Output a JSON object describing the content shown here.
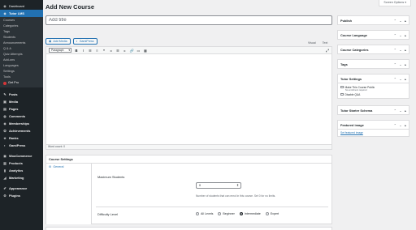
{
  "sidebar": {
    "dashboard": "Dashboard",
    "tutor_lms": "Tutor LMS",
    "tutor_sub": [
      "Courses",
      "Categories",
      "Tags",
      "Students",
      "Announcements",
      "Q & A",
      "Quiz Attempts",
      "Add-ons",
      "Languages",
      "Settings",
      "Tools"
    ],
    "get_pro": "Get Pro",
    "posts": "Posts",
    "media": "Media",
    "pages": "Pages",
    "comments": "Comments",
    "memberships": "Memberships",
    "achievements": "Achievements",
    "ranks": "Ranks",
    "gamipress": "GamiPress",
    "woocommerce": "WooCommerce",
    "products": "Products",
    "analytics": "Analytics",
    "marketing": "Marketing",
    "appearance": "Appearance",
    "plugins": "Plugins"
  },
  "header": {
    "title": "Add New Course",
    "screen_options": "Screen Options ▾"
  },
  "title_field": {
    "placeholder": "Add title"
  },
  "media_buttons": {
    "add_media": "Add Media",
    "gamipress": "GamiPress"
  },
  "editor_tabs": {
    "visual": "Visual",
    "text": "Text"
  },
  "toolbar": {
    "format": "Paragraph",
    "format_arrow": "▾",
    "bold": "B",
    "italic": "I",
    "ul": "☰",
    "ol": "≡",
    "quote": "❝",
    "align_left": "⫷",
    "align_center": "☰",
    "align_right": "⫸",
    "link": "🔗",
    "more": "▭",
    "kitchen_sink": "▦",
    "expand": "⤢"
  },
  "word_count": "Word count: 0",
  "course_settings": {
    "title": "Course Settings",
    "nav_general": "General",
    "max_students_label": "Maximum Students",
    "max_students_value": "0",
    "max_students_help": "Number of students that can enrol in this course. Set 0 for no limits.",
    "difficulty_label": "Difficulty Level",
    "levels": [
      "All Levels",
      "Beginner",
      "Intermediate",
      "Expert"
    ],
    "selected_level": "Intermediate"
  },
  "right_boxes": {
    "publish": "Publish",
    "course_language": "Course Language",
    "course_categories": "Course Categories",
    "tags": "Tags",
    "tutor_settings": "Tutor Settings",
    "make_public": "Make This Course Public",
    "no_enrollment": "No enrollment required",
    "disable_qa": "Disable Q&A",
    "tutor_starter_schema": "Tutor Starter Schema",
    "featured_image": "Featured image",
    "set_featured_image": "Set featured image",
    "box_controls": "⌃ ⌄ ▴"
  },
  "colors": {
    "sidebar_bg": "#1d2327",
    "accent": "#2271b1",
    "page_bg": "#f0f0f1"
  }
}
